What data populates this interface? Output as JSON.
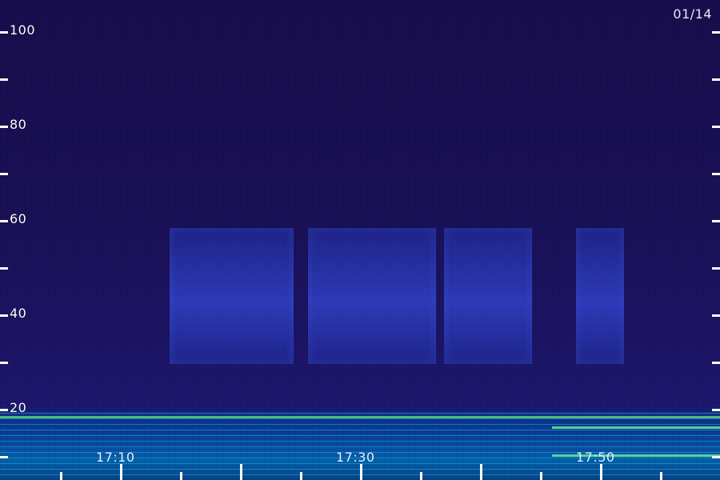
{
  "chart_data": {
    "type": "heatmap",
    "date_label": "01/14",
    "y_ticks": [
      100,
      80,
      60,
      40,
      20
    ],
    "x_ticks": [
      "17:10",
      "17:30",
      "17:50"
    ],
    "ylim": [
      10,
      105
    ],
    "xlim_minutes": [
      17.0,
      18.0
    ],
    "colors": {
      "background": "#1a0f55",
      "band": "#3b5bff",
      "low_freq": "#00e0ff",
      "highlight": "#78ff78"
    }
  }
}
